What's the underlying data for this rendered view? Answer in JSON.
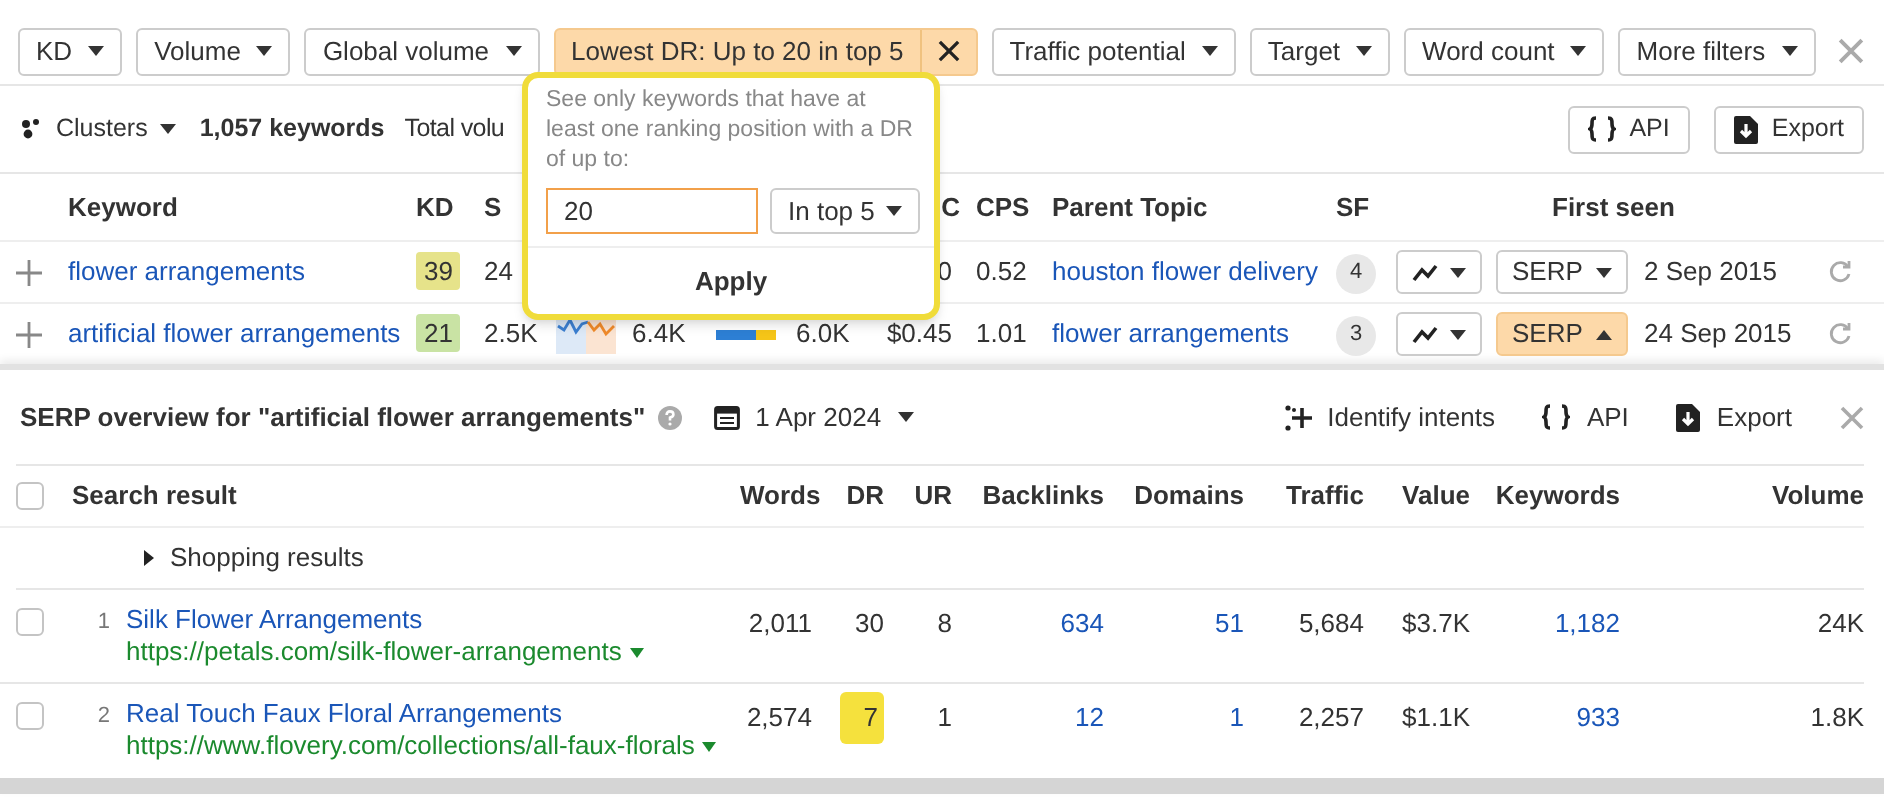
{
  "filters": [
    {
      "label": "KD",
      "active": false
    },
    {
      "label": "Volume",
      "active": false
    },
    {
      "label": "Global volume",
      "active": false
    },
    {
      "label": "Lowest DR: Up to 20 in top 5",
      "active": true
    },
    {
      "label": "Traffic potential",
      "active": false
    },
    {
      "label": "Target",
      "active": false
    },
    {
      "label": "Word count",
      "active": false
    },
    {
      "label": "More filters",
      "active": false
    }
  ],
  "toolbar": {
    "clusters": "Clusters",
    "count": "1,057 keywords",
    "total": "Total volu",
    "buttons": [
      {
        "kind": "api",
        "label": "API"
      },
      {
        "kind": "export",
        "label": "Export"
      }
    ]
  },
  "popover": {
    "description": "See only keywords that have at least one ranking position with a DR of up to:",
    "value": "20",
    "select": "In top 5",
    "apply": "Apply"
  },
  "keyword_table": {
    "header": {
      "keyword": "Keyword",
      "kd": "KD",
      "volume": "S",
      "cpc": "C",
      "cps": "CPS",
      "parent_topic": "Parent Topic",
      "sf": "SF",
      "first_seen": "First seen"
    },
    "rows": [
      {
        "keyword": "flower arrangements",
        "kd": "39",
        "color": "#e6e38a",
        "volume": "24",
        "cpc": "0",
        "cps": "0.52",
        "parent_topic": "houston flower delivery",
        "sf": "4",
        "serp_label": "SERP",
        "serp_expanded": false,
        "first_seen": "2 Sep 2015"
      },
      {
        "keyword": "artificial flower arrangements",
        "kd": "21",
        "color": "#c9e3a4",
        "volume": "2.5K",
        "global_volume": "6.4K",
        "traffic_potential": "6.0K",
        "cpc": "$0.45",
        "cps": "1.01",
        "parent_topic": "flower arrangements",
        "sf": "3",
        "serp_label": "SERP",
        "serp_expanded": true,
        "first_seen": "24 Sep 2015"
      }
    ]
  },
  "serp": {
    "title": "SERP overview for \"artificial flower arrangements\"",
    "date": "1 Apr 2024",
    "actions": [
      {
        "kind": "intents",
        "label": "Identify intents"
      },
      {
        "kind": "api",
        "label": "API"
      },
      {
        "kind": "export",
        "label": "Export"
      }
    ],
    "header_checked": false,
    "columns": [
      "Search result",
      "Words",
      "DR",
      "UR",
      "Backlinks",
      "Domains",
      "Traffic",
      "Value",
      "Keywords",
      "Volume"
    ],
    "shopping": "Shopping results",
    "results": [
      {
        "checked": false,
        "rank": "1",
        "title": "Silk Flower Arrangements",
        "url": "https://petals.com/silk-flower-arrangements",
        "words": "2,011",
        "dr": "30",
        "dr_highlight": false,
        "ur": "8",
        "backlinks": "634",
        "domains": "51",
        "traffic": "5,684",
        "value": "$3.7K",
        "keywords": "1,182",
        "volume": "24K"
      },
      {
        "checked": false,
        "rank": "2",
        "title": "Real Touch Faux Floral Arrangements",
        "url": "https://www.flovery.com/collections/all-faux-florals",
        "words": "2,574",
        "dr": "7",
        "dr_highlight": true,
        "ur": "1",
        "backlinks": "12",
        "domains": "1",
        "traffic": "2,257",
        "value": "$1.1K",
        "keywords": "933",
        "volume": "1.8K"
      }
    ]
  }
}
